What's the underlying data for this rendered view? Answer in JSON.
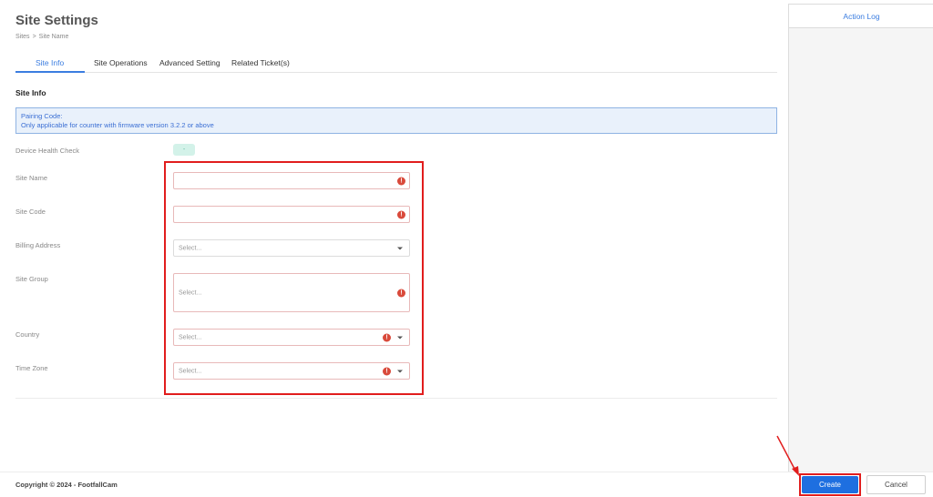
{
  "page": {
    "title": "Site Settings",
    "breadcrumb": [
      "Sites",
      ">",
      "Site Name"
    ]
  },
  "tabs": [
    {
      "label": "Site Info",
      "active": true
    },
    {
      "label": "Site Operations",
      "active": false
    },
    {
      "label": "Advanced Setting",
      "active": false
    },
    {
      "label": "Related Ticket(s)",
      "active": false
    }
  ],
  "section": {
    "title": "Site Info"
  },
  "info_box": {
    "line1": "Pairing Code:",
    "line2": "Only applicable for counter with firmware version 3.2.2 or above"
  },
  "device_health": {
    "label": "Device Health Check",
    "value": "-"
  },
  "fields": {
    "site_name": {
      "label": "Site Name",
      "value": ""
    },
    "site_code": {
      "label": "Site Code",
      "value": ""
    },
    "billing_address": {
      "label": "Billing Address",
      "placeholder": "Select..."
    },
    "site_group": {
      "label": "Site Group",
      "placeholder": "Select..."
    },
    "country": {
      "label": "Country",
      "placeholder": "Select..."
    },
    "time_zone": {
      "label": "Time Zone",
      "placeholder": "Select..."
    }
  },
  "icons": {
    "warning": "!"
  },
  "sidebar": {
    "title": "Action Log"
  },
  "footer": {
    "copyright": "Copyright © 2024 - FootfallCam"
  },
  "buttons": {
    "create": "Create",
    "cancel": "Cancel"
  },
  "colors": {
    "accent": "#3b7de0",
    "primary_button": "#1e6fe0",
    "error": "#d94a3b",
    "annotation": "#e11d1d"
  }
}
